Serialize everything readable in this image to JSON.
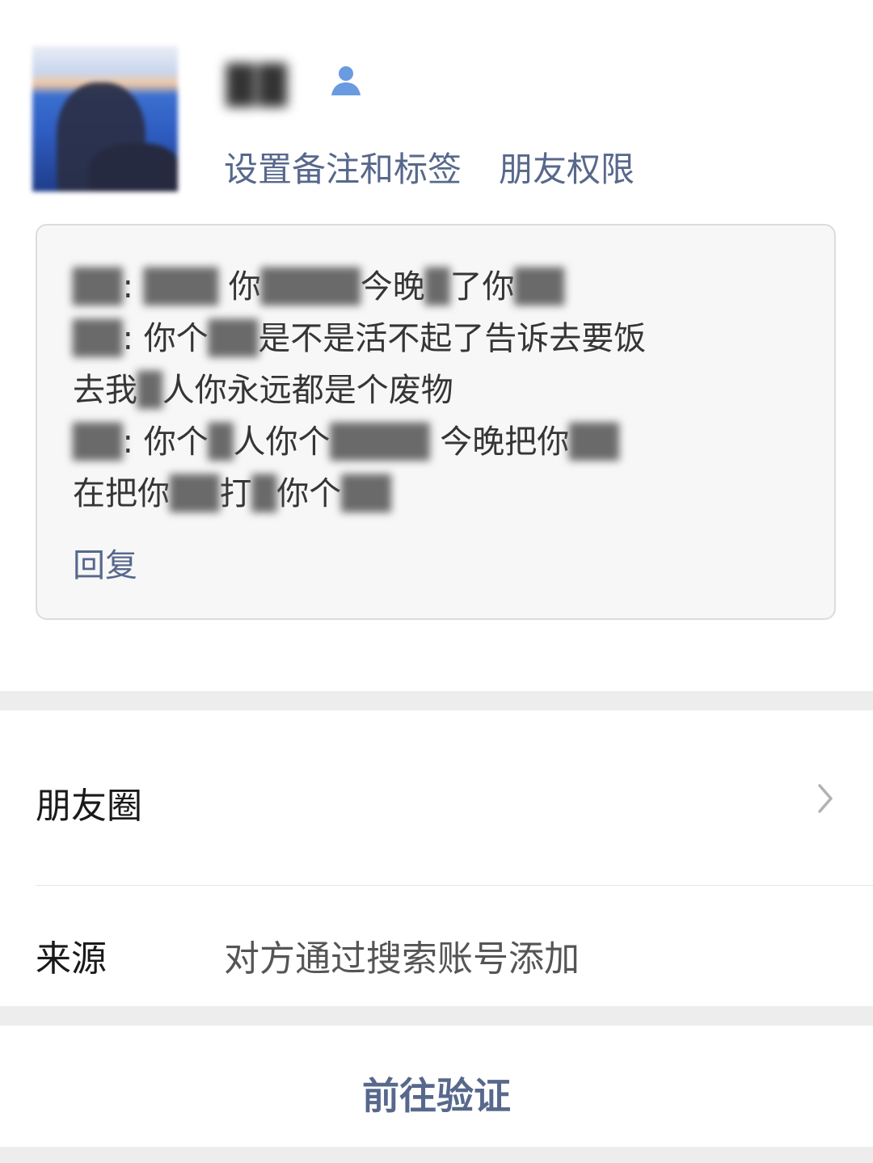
{
  "profile": {
    "name_masked": "██",
    "actions": [
      "设置备注和标签",
      "朋友权限"
    ]
  },
  "message": {
    "lines": [
      [
        {
          "t": "██",
          "b": true
        },
        {
          "t": ": "
        },
        {
          "t": "███ ",
          "b": true
        },
        {
          "t": "你"
        },
        {
          "t": "████",
          "b": true
        },
        {
          "t": "今晚"
        },
        {
          "t": "█",
          "b": true
        },
        {
          "t": "了你"
        },
        {
          "t": "██",
          "b": true
        }
      ],
      [
        {
          "t": "██",
          "b": true
        },
        {
          "t": ": 你个"
        },
        {
          "t": "██",
          "b": true
        },
        {
          "t": "是不是活不起了告诉去要饭"
        }
      ],
      [
        {
          "t": "去我"
        },
        {
          "t": "█",
          "b": true
        },
        {
          "t": "人你永远都是个废物"
        }
      ],
      [
        {
          "t": "██",
          "b": true
        },
        {
          "t": ": 你个"
        },
        {
          "t": "█",
          "b": true
        },
        {
          "t": "人你个"
        },
        {
          "t": "████",
          "b": true
        },
        {
          "t": " 今晚把你"
        },
        {
          "t": "██",
          "b": true
        }
      ],
      [
        {
          "t": "在把你"
        },
        {
          "t": "██",
          "b": true
        },
        {
          "t": "打"
        },
        {
          "t": "█",
          "b": true
        },
        {
          "t": "你个"
        },
        {
          "t": "██",
          "b": true
        }
      ]
    ],
    "reply_label": "回复"
  },
  "moments_label": "朋友圈",
  "source": {
    "label": "来源",
    "value": "对方通过搜索账号添加"
  },
  "verify_button": "前往验证",
  "colors": {
    "link": "#57688c",
    "bg_gray": "#ededed",
    "box": "#f7f7f7"
  },
  "icons": {
    "contact": "contact-person-icon",
    "chevron": "chevron-right-icon"
  }
}
